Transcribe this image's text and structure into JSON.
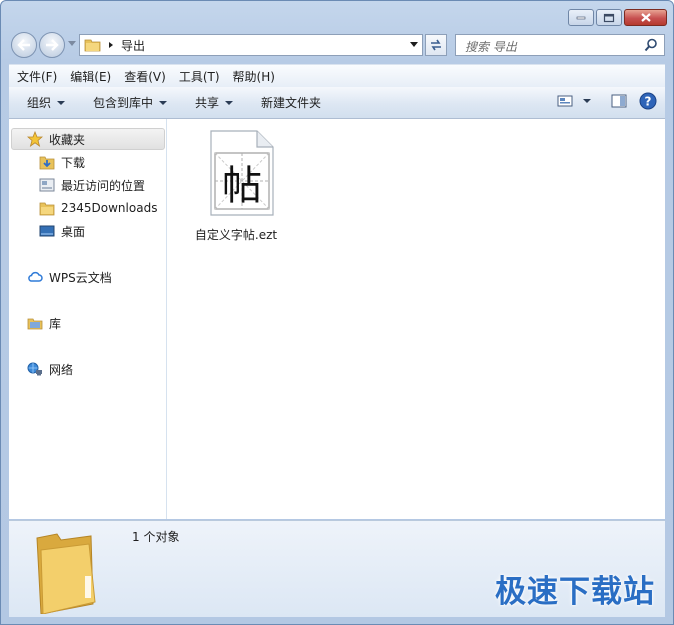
{
  "window": {
    "address_path": "导出",
    "search_placeholder": "搜索 导出"
  },
  "menu": [
    "文件(F)",
    "编辑(E)",
    "查看(V)",
    "工具(T)",
    "帮助(H)"
  ],
  "toolbar": {
    "organize": "组织",
    "include_in_library": "包含到库中",
    "share": "共享",
    "new_folder": "新建文件夹"
  },
  "nav_pane": {
    "favorites": "收藏夹",
    "downloads": "下载",
    "recent": "最近访问的位置",
    "folder_2345": "2345Downloads",
    "desktop": "桌面",
    "wps_cloud": "WPS云文档",
    "libraries": "库",
    "network": "网络"
  },
  "files": [
    {
      "name": "自定义字帖.ezt",
      "glyph": "帖"
    }
  ],
  "details": {
    "count_text": "1 个对象"
  },
  "watermark": "极速下载站",
  "colors": {
    "accent": "#2a6ec4",
    "close": "#c75050",
    "folder": "#e8c25a"
  }
}
